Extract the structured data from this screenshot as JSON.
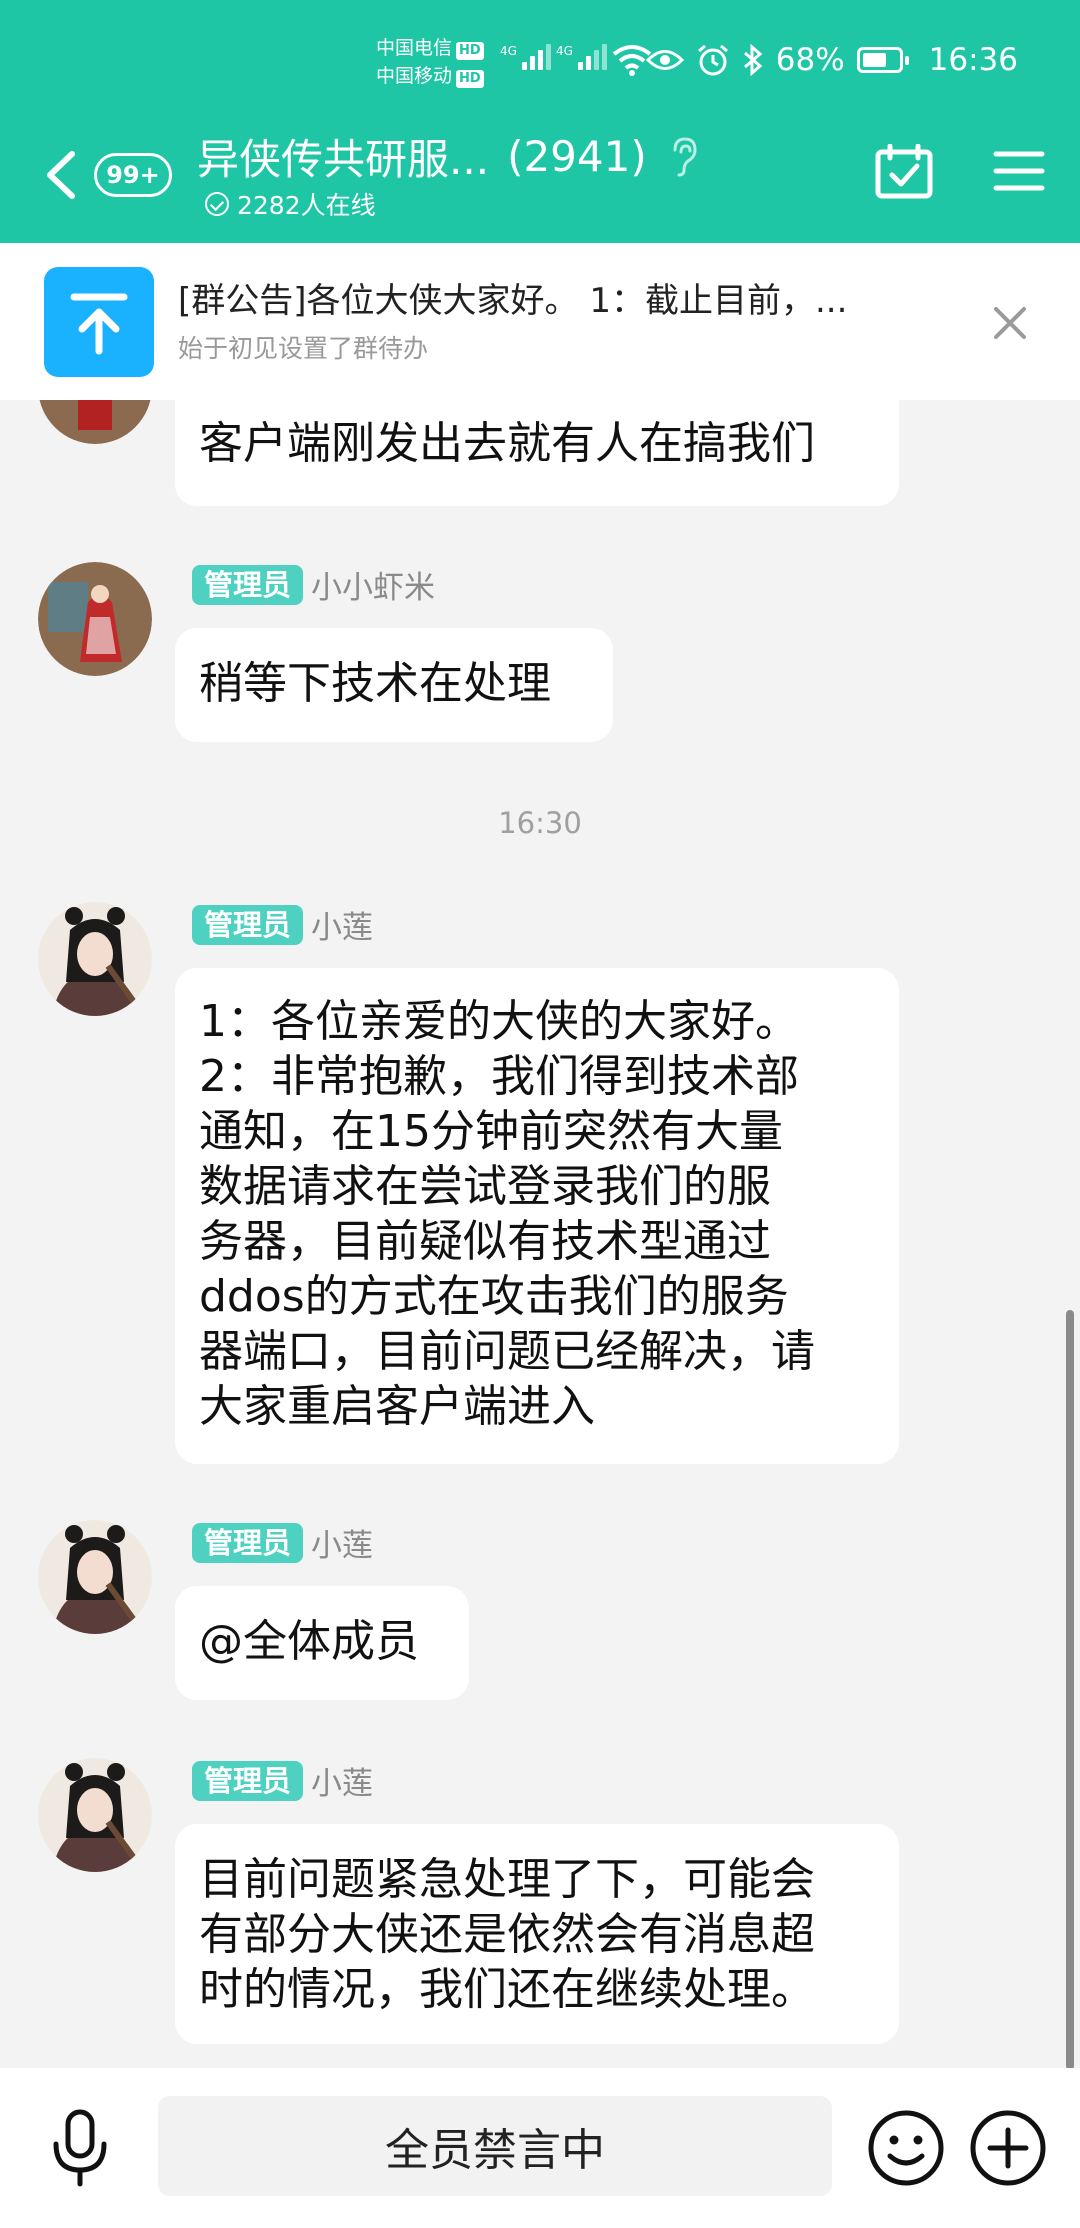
{
  "colors": {
    "brand": "#1fc6a6",
    "badge": "#4fd1c2",
    "announce_icon": "#1ab2ff"
  },
  "status_bar": {
    "carrier_1": "中国电信",
    "carrier_2": "中国移动",
    "hd": "HD",
    "network_1": "4G",
    "network_2": "4G",
    "battery_percent": "68%",
    "battery_level": 0.68,
    "time": "16:36"
  },
  "header": {
    "unread_badge": "99+",
    "group_title": "异侠传共研服...",
    "member_count": "(2941)",
    "online_text": "2282人在线"
  },
  "announcement": {
    "title": "[群公告]各位大侠大家好。 1：截止目前，...",
    "subtitle": "始于初见设置了群待办"
  },
  "messages": [
    {
      "text": "客户端刚发出去就有人在搞我们"
    },
    {
      "role": "管理员",
      "name": "小小虾米",
      "text": "稍等下技术在处理"
    },
    {
      "time": "16:30"
    },
    {
      "role": "管理员",
      "name": "小莲",
      "lines": [
        "1：各位亲爱的大侠的大家好。",
        "2：非常抱歉，我们得到技术部",
        "通知，在15分钟前突然有大量",
        "数据请求在尝试登录我们的服",
        "务器，目前疑似有技术型通过",
        "ddos的方式在攻击我们的服务",
        "器端口，目前问题已经解决，请",
        "大家重启客户端进入"
      ]
    },
    {
      "role": "管理员",
      "name": "小莲",
      "text": "@全体成员"
    },
    {
      "role": "管理员",
      "name": "小莲",
      "lines": [
        "目前问题紧急处理了下，可能会",
        "有部分大侠还是依然会有消息超",
        "时的情况，我们还在继续处理。"
      ]
    }
  ],
  "bottom_bar": {
    "mute_text": "全员禁言中"
  }
}
